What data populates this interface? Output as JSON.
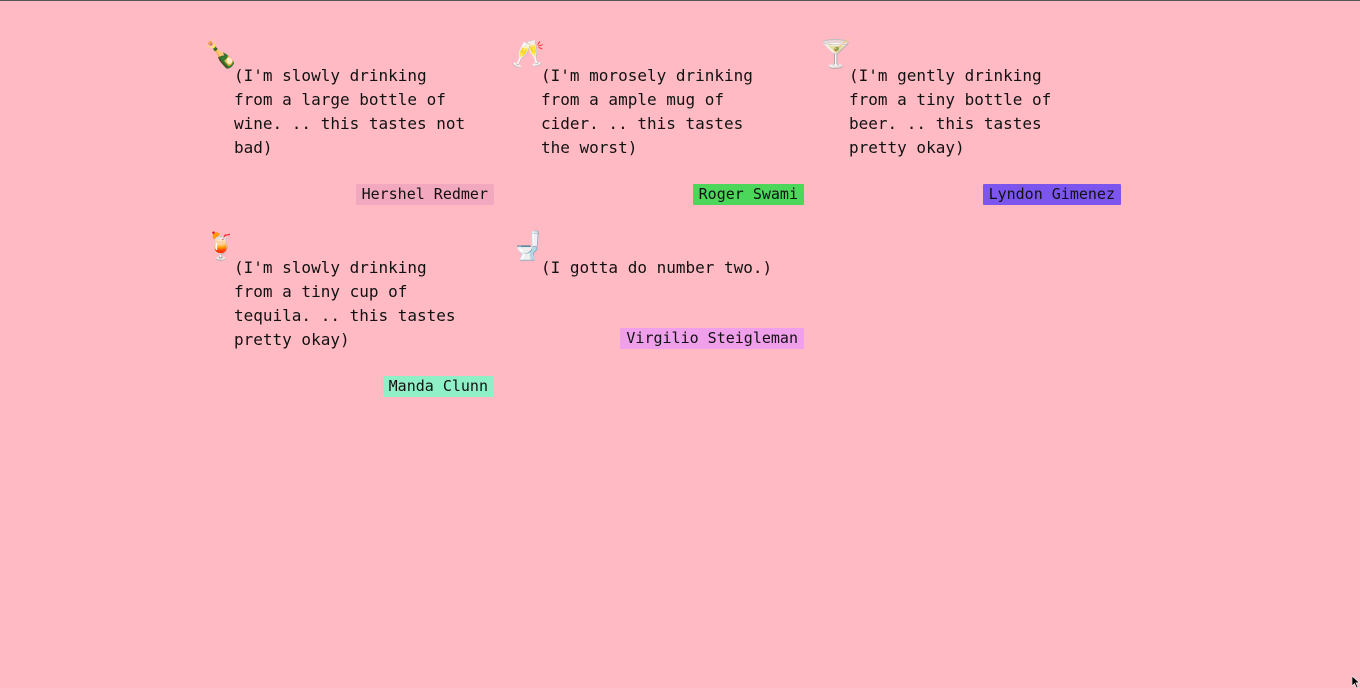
{
  "posts": [
    {
      "icon": "🍾",
      "icon_name": "champagne-bottle-icon",
      "text": "(I'm slowly drinking from a large bottle of wine. .. this tastes not bad)",
      "author": "Hershel Redmer",
      "author_color": "#f2a8be"
    },
    {
      "icon": "🥂",
      "icon_name": "clinking-glasses-icon",
      "text": "(I'm morosely drinking from a ample mug of cider. .. this tastes the worst)",
      "author": "Roger Swami",
      "author_color": "#4cd65a"
    },
    {
      "icon": "🍸",
      "icon_name": "cocktail-glass-icon",
      "text": "(I'm gently drinking from a tiny bottle of beer. .. this tastes pretty okay)",
      "author": "Lyndon Gimenez",
      "author_color": "#7b55ee"
    },
    {
      "icon": "🍹",
      "icon_name": "tropical-drink-icon",
      "text": "(I'm slowly drinking from a tiny cup of tequila. .. this tastes pretty okay)",
      "author": "Manda Clunn",
      "author_color": "#8ff0c8"
    },
    {
      "icon": "🚽",
      "icon_name": "toilet-icon",
      "text": "(I gotta do number two.)",
      "author": "Virgilio Steigleman",
      "author_color": "#f0a0ea"
    }
  ],
  "page": {
    "background": "#ffbac4"
  }
}
